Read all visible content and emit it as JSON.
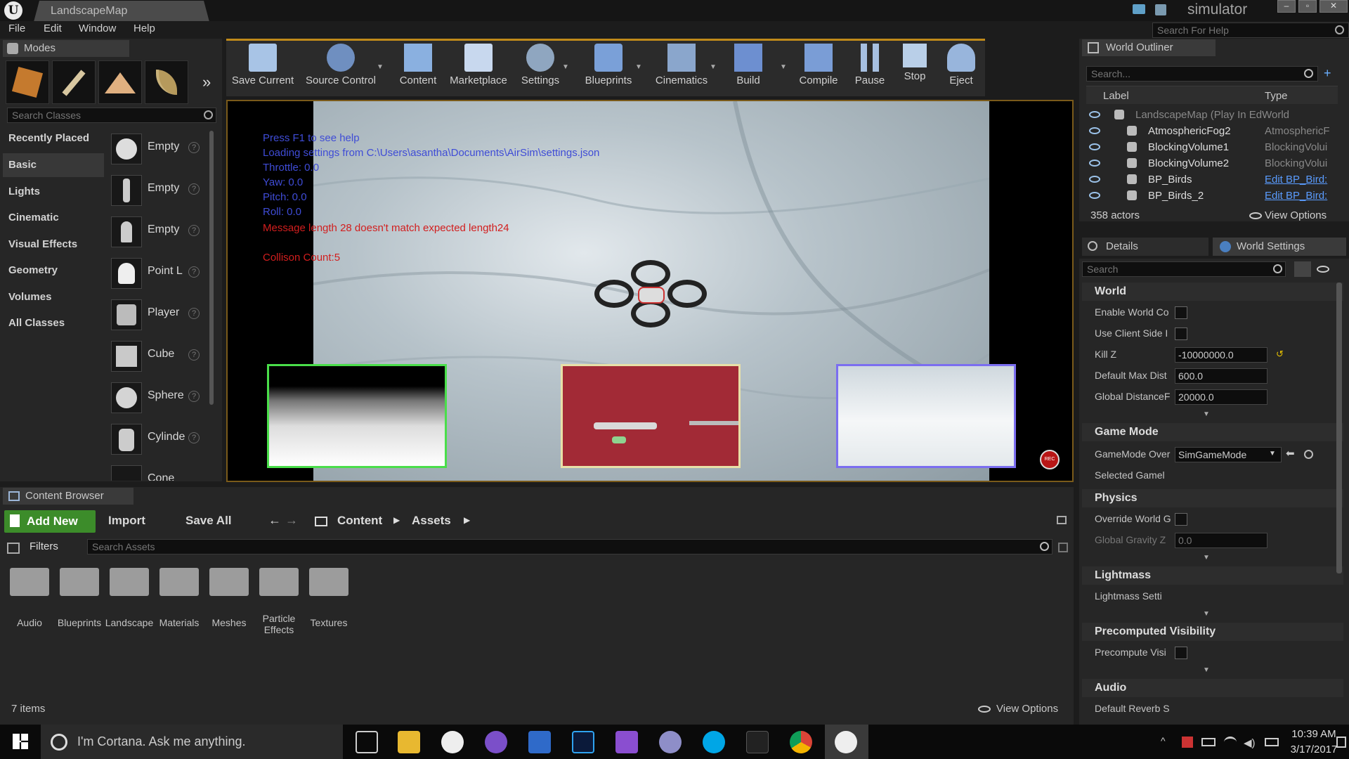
{
  "window": {
    "title": "LandscapeMap",
    "project": "simulator",
    "help_search_placeholder": "Search For Help"
  },
  "menu": [
    "File",
    "Edit",
    "Window",
    "Help"
  ],
  "modes": {
    "tab": "Modes",
    "search_placeholder": "Search Classes",
    "categories": [
      "Recently Placed",
      "Basic",
      "Lights",
      "Cinematic",
      "Visual Effects",
      "Geometry",
      "Volumes",
      "All Classes"
    ],
    "items": [
      "Empty",
      "Empty",
      "Empty",
      "Point L",
      "Player",
      "Cube",
      "Sphere",
      "Cylinde",
      "Cone"
    ]
  },
  "toolbar": [
    "Save Current",
    "Source Control",
    "Content",
    "Marketplace",
    "Settings",
    "Blueprints",
    "Cinematics",
    "Build",
    "Compile",
    "Pause",
    "Stop",
    "Eject"
  ],
  "viewport": {
    "hud": [
      "Press F1 to see help",
      "Loading settings from C:\\Users\\asantha\\Documents\\AirSim\\settings.json",
      "Throttle: 0.0",
      "Yaw: 0.0",
      "Pitch: 0.0",
      "Roll: 0.0"
    ],
    "message": "Message length 28 doesn't match expected length24",
    "collision": "Collison Count:5",
    "rec": "REC"
  },
  "outliner": {
    "tab": "World Outliner",
    "search_placeholder": "Search...",
    "col_label": "Label",
    "col_type": "Type",
    "rows": [
      {
        "label": "LandscapeMap (Play In EdWorld",
        "type": ""
      },
      {
        "label": "AtmosphericFog2",
        "type": "AtmosphericF"
      },
      {
        "label": "BlockingVolume1",
        "type": "BlockingVolui"
      },
      {
        "label": "BlockingVolume2",
        "type": "BlockingVolui"
      },
      {
        "label": "BP_Birds",
        "type": "Edit BP_Bird:"
      },
      {
        "label": "BP_Birds_2",
        "type": "Edit BP_Bird:"
      }
    ],
    "count": "358 actors",
    "view_options": "View Options"
  },
  "details": {
    "tab_details": "Details",
    "tab_world": "World Settings",
    "search_placeholder": "Search",
    "world_section": "World",
    "world_props": [
      {
        "label": "Enable World Co",
        "kind": "check"
      },
      {
        "label": "Use Client Side I",
        "kind": "check"
      },
      {
        "label": "Kill Z",
        "value": "-10000000.0"
      },
      {
        "label": "Default Max Dist",
        "value": "600.0"
      },
      {
        "label": "Global DistanceF",
        "value": "20000.0"
      }
    ],
    "gamemode_section": "Game Mode",
    "gamemode_label": "GameMode Over",
    "gamemode_value": "SimGameMode",
    "selected_game": "Selected Gamel",
    "physics_section": "Physics",
    "physics_props": [
      {
        "label": "Override World G",
        "kind": "check"
      },
      {
        "label": "Global Gravity Z",
        "value": "0.0"
      }
    ],
    "lightmass_section": "Lightmass",
    "lightmass_label": "Lightmass Setti",
    "precomputed_section": "Precomputed Visibility",
    "precomputed_label": "Precompute Visi",
    "audio_section": "Audio",
    "audio_label": "Default Reverb S"
  },
  "content_browser": {
    "tab": "Content Browser",
    "add_new": "Add New",
    "import": "Import",
    "save_all": "Save All",
    "path": [
      "Content",
      "Assets"
    ],
    "filters": "Filters",
    "search_placeholder": "Search Assets",
    "folders": [
      "Audio",
      "Blueprints",
      "Landscape",
      "Materials",
      "Meshes",
      "Particle Effects",
      "Textures"
    ],
    "count": "7 items",
    "view_options": "View Options"
  },
  "taskbar": {
    "cortana": "I'm Cortana. Ask me anything.",
    "time": "10:39 AM",
    "date": "3/17/2017",
    "apps": [
      "task-view",
      "file-explorer",
      "unreal-engine",
      "viber",
      "powershell",
      "photoshop",
      "visual-studio",
      "app",
      "skype",
      "epic-games",
      "chrome",
      "unreal-engine-active"
    ]
  },
  "colors": {
    "accent": "#c08a1a",
    "add_new": "#3c8c2a",
    "hud_blue": "#3f4cd6",
    "hud_red": "#d21e1e"
  }
}
